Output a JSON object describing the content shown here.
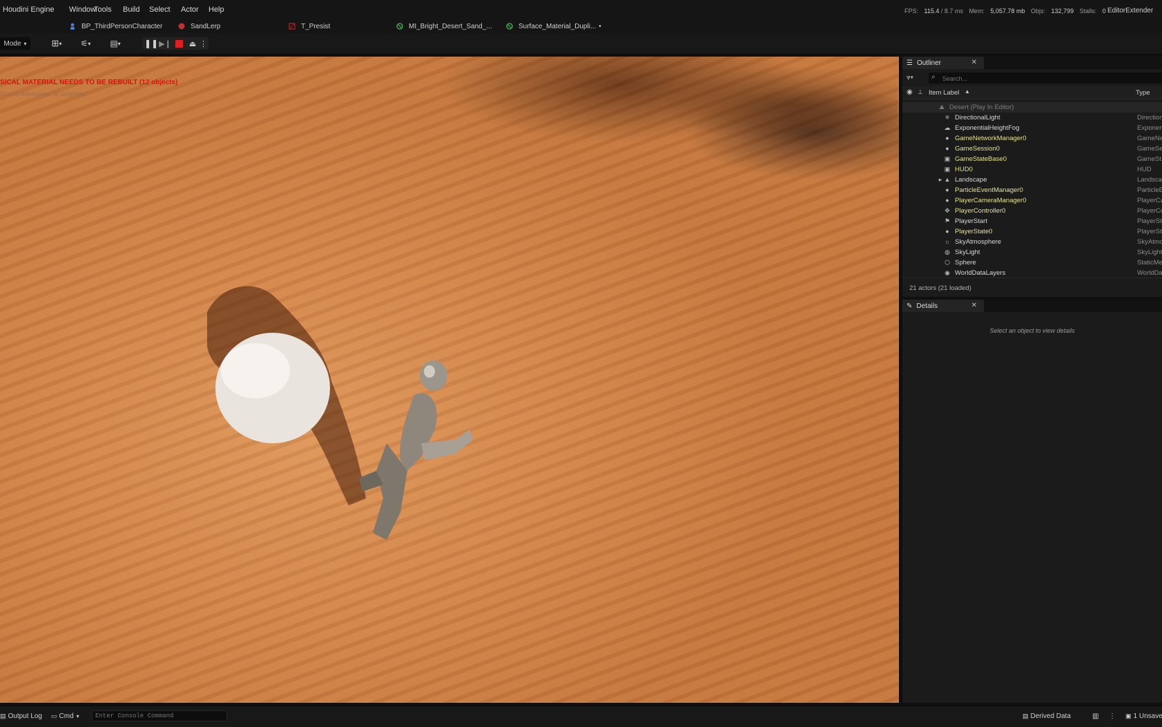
{
  "menubar": {
    "items": [
      "Houdini Engine",
      "Window",
      "Tools",
      "Build",
      "Select",
      "Actor",
      "Help"
    ],
    "stats": {
      "fps_label": "FPS:",
      "fps_value": "115.4",
      "ms_value": "/ 8.7 ms",
      "mem_label": "Mem:",
      "mem_value": "5,057.78 mb",
      "objs_label": "Objs:",
      "objs_value": "132,799",
      "stalls_label": "Stalls:",
      "stalls_value": "0"
    },
    "editor_extender": "EditorExtender"
  },
  "tabs": [
    {
      "label": "BP_ThirdPersonCharacter",
      "icon": "blueprint-icon",
      "color": "#4d7bd6"
    },
    {
      "label": "SandLerp",
      "icon": "material-icon",
      "color": "#c03030"
    },
    {
      "label": "T_Presist",
      "icon": "texture-icon",
      "color": "#a02020"
    },
    {
      "label": "MI_Bright_Desert_Sand_...",
      "icon": "material-instance-icon",
      "color": "#3aa048"
    },
    {
      "label": "Surface_Material_Dupli...",
      "icon": "material-instance-icon",
      "color": "#3aa048",
      "modified": "•"
    }
  ],
  "toolbar": {
    "mode_label": "Mode"
  },
  "viewport": {
    "warning": "SICAL MATERIAL NEEDS TO BE REBUILT (12 objects)",
    "hint": "llScreenMessages' to suppress"
  },
  "outliner": {
    "tab_label": "Outliner",
    "search_placeholder": "Search...",
    "col_label": "Item Label",
    "col_type": "Type",
    "root": "Desert (Play In Editor)",
    "items": [
      {
        "label": "DirectionalLight",
        "type": "Direction",
        "icon": "directional-light-icon",
        "color": "white"
      },
      {
        "label": "ExponentialHeightFog",
        "type": "Exponen",
        "icon": "fog-icon",
        "color": "white"
      },
      {
        "label": "GameNetworkManager0",
        "type": "GameNe",
        "icon": "actor-icon",
        "color": "yellow"
      },
      {
        "label": "GameSession0",
        "type": "GameSe",
        "icon": "actor-icon",
        "color": "yellow"
      },
      {
        "label": "GameStateBase0",
        "type": "GameSt",
        "icon": "game-state-icon",
        "color": "yellow"
      },
      {
        "label": "HUD0",
        "type": "HUD",
        "icon": "hud-icon",
        "color": "yellow"
      },
      {
        "label": "Landscape",
        "type": "Landsca",
        "icon": "landscape-icon",
        "color": "white",
        "expandable": true
      },
      {
        "label": "ParticleEventManager0",
        "type": "ParticleE",
        "icon": "actor-icon",
        "color": "yellow"
      },
      {
        "label": "PlayerCameraManager0",
        "type": "PlayerCa",
        "icon": "actor-icon",
        "color": "yellow"
      },
      {
        "label": "PlayerController0",
        "type": "PlayerCo",
        "icon": "controller-icon",
        "color": "yellow"
      },
      {
        "label": "PlayerStart",
        "type": "PlayerSt",
        "icon": "player-start-icon",
        "color": "white"
      },
      {
        "label": "PlayerState0",
        "type": "PlayerSt",
        "icon": "actor-icon",
        "color": "yellow"
      },
      {
        "label": "SkyAtmosphere",
        "type": "SkyAtmo",
        "icon": "sky-atmosphere-icon",
        "color": "white"
      },
      {
        "label": "SkyLight",
        "type": "SkyLight",
        "icon": "sky-light-icon",
        "color": "white"
      },
      {
        "label": "Sphere",
        "type": "StaticMe",
        "icon": "static-mesh-icon",
        "color": "white"
      },
      {
        "label": "WorldDataLayers",
        "type": "WorldDa",
        "icon": "world-data-layers-icon",
        "color": "white"
      }
    ],
    "footer": "21 actors (21 loaded)"
  },
  "details": {
    "tab_label": "Details",
    "empty_message": "Select an object to view details"
  },
  "bottombar": {
    "output_log": "Output Log",
    "cmd": "Cmd",
    "console_placeholder": "Enter Console Command",
    "derived_data": "Derived Data",
    "unsaved": "1 Unsave"
  }
}
